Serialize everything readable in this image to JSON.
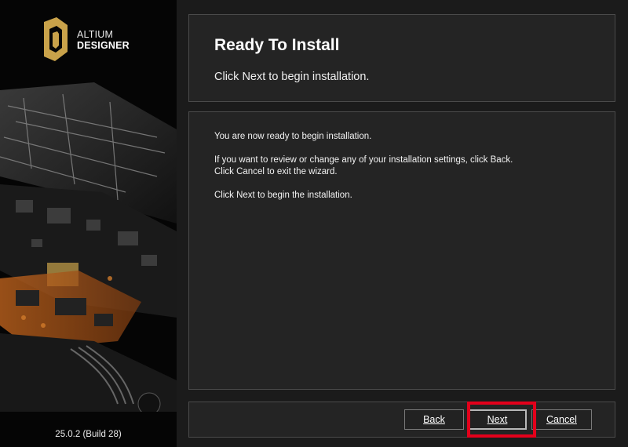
{
  "sidebar": {
    "logo_line1": "ALTIUM",
    "logo_line2": "DESIGNER",
    "version": "25.0.2 (Build 28)"
  },
  "header": {
    "title": "Ready To Install",
    "subtitle": "Click Next to begin installation."
  },
  "content": {
    "line1": "You are now ready to begin installation.",
    "line2": "If you want to review or change any of your installation settings, click Back.",
    "line3": "Click Cancel to exit the wizard.",
    "line4": "Click Next to begin the installation."
  },
  "footer": {
    "back_label": "Back",
    "next_label": "Next",
    "cancel_label": "Cancel"
  },
  "colors": {
    "accent_gold": "#c9a24a",
    "highlight_red": "#e3001b",
    "background": "#1b1b1b"
  }
}
